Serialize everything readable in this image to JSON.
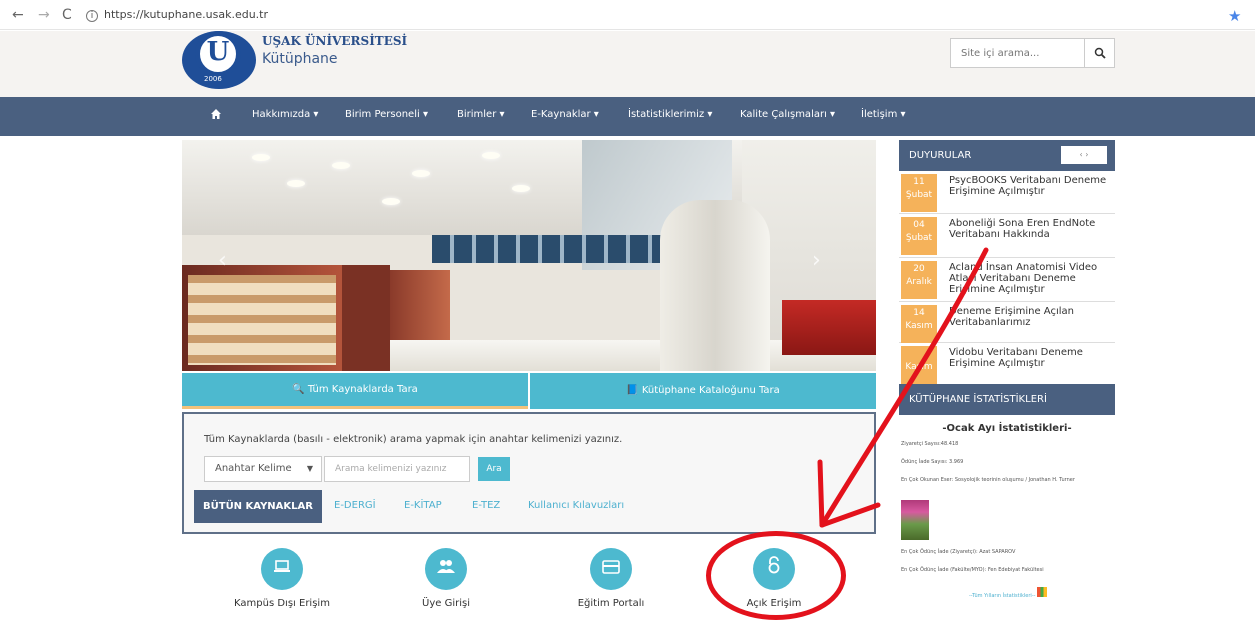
{
  "browser": {
    "url": "https://kutuphane.usak.edu.tr",
    "back": "←",
    "forward": "→",
    "reload": "C",
    "info": "i",
    "star": "★"
  },
  "header": {
    "university": "UŞAK ÜNİVERSİTESİ",
    "library": "Kütüphane",
    "logo_letter": "U",
    "logo_ring": "T.C. UŞAK ÜNİVERSİTESİ",
    "logo_year": "2006",
    "search_placeholder": "Site içi arama...",
    "search_icon": "search-icon"
  },
  "nav": {
    "home_icon": "home-icon",
    "items": [
      {
        "label": "Hakkımızda ▾"
      },
      {
        "label": "Birim Personeli ▾"
      },
      {
        "label": "Birimler ▾"
      },
      {
        "label": "E-Kaynaklar ▾"
      },
      {
        "label": "İstatistiklerimiz ▾"
      },
      {
        "label": "Kalite Çalışmaları ▾"
      },
      {
        "label": "İletişim ▾"
      }
    ]
  },
  "hero": {
    "prev": "‹",
    "next": "›"
  },
  "search_tabs": {
    "all": "🔍 Tüm Kaynaklarda Tara",
    "catalog": "📘 Kütüphane Kataloğunu Tara"
  },
  "search_panel": {
    "description": "Tüm Kaynaklarda (basılı - elektronik) arama yapmak için anahtar kelimenizi yazınız.",
    "select_value": "Anahtar Kelime",
    "input_placeholder": "Arama kelimenizi yazınız",
    "button": "Ara",
    "all_resources": "BÜTÜN KAYNAKLAR",
    "links": [
      "E-DERGİ",
      "E-KİTAP",
      "E-TEZ",
      "Kullanıcı Kılavuzları"
    ]
  },
  "quick_links": [
    {
      "label": "Kampüs Dışı Erişim",
      "icon": "laptop-icon"
    },
    {
      "label": "Üye Girişi",
      "icon": "users-icon"
    },
    {
      "label": "Eğitim Portalı",
      "icon": "card-icon"
    },
    {
      "label": "Açık Erişim",
      "icon": "open-lock-icon"
    }
  ],
  "announcements": {
    "title": "DUYURULAR",
    "controls": "‹ ›",
    "items": [
      {
        "day": "11",
        "month": "Şubat",
        "text": "PsycBOOKS Veritabanı Deneme Erişimine Açılmıştır"
      },
      {
        "day": "04",
        "month": "Şubat",
        "text": "Aboneliği Sona Eren EndNote Veritabanı Hakkında"
      },
      {
        "day": "20",
        "month": "Aralık",
        "text": "Acland İnsan Anatomisi Video Atlası Veritabanı Deneme Erişimine Açılmıştır"
      },
      {
        "day": "14",
        "month": "Kasım",
        "text": "Deneme Erişimine Açılan Veritabanlarımız"
      },
      {
        "day": "",
        "month": "Kasım",
        "text": "Vidobu Veritabanı Deneme Erişimine Açılmıştır"
      }
    ]
  },
  "stats": {
    "title": "KÜTÜPHANE İSTATİSTİKLERİ",
    "subtitle": "-Ocak Ayı İstatistikleri-",
    "lines": [
      "Ziyaretçi Sayısı:48.418",
      "Ödünç İade Sayısı: 3.969",
      "En Çok Okunan Eser: Sosyolojik teorinin oluşumu / Jonathan H. Turner",
      "En Çok Ödünç İade (Ziyaretçi): Azat SAPAROV",
      "En Çok Ödünç İade (Fakülte/MYO): Fen Edebiyat Fakültesi"
    ],
    "all_link": "--Tüm Yılların İstatistikleri--"
  },
  "annotation": {
    "color": "#e3121c"
  }
}
